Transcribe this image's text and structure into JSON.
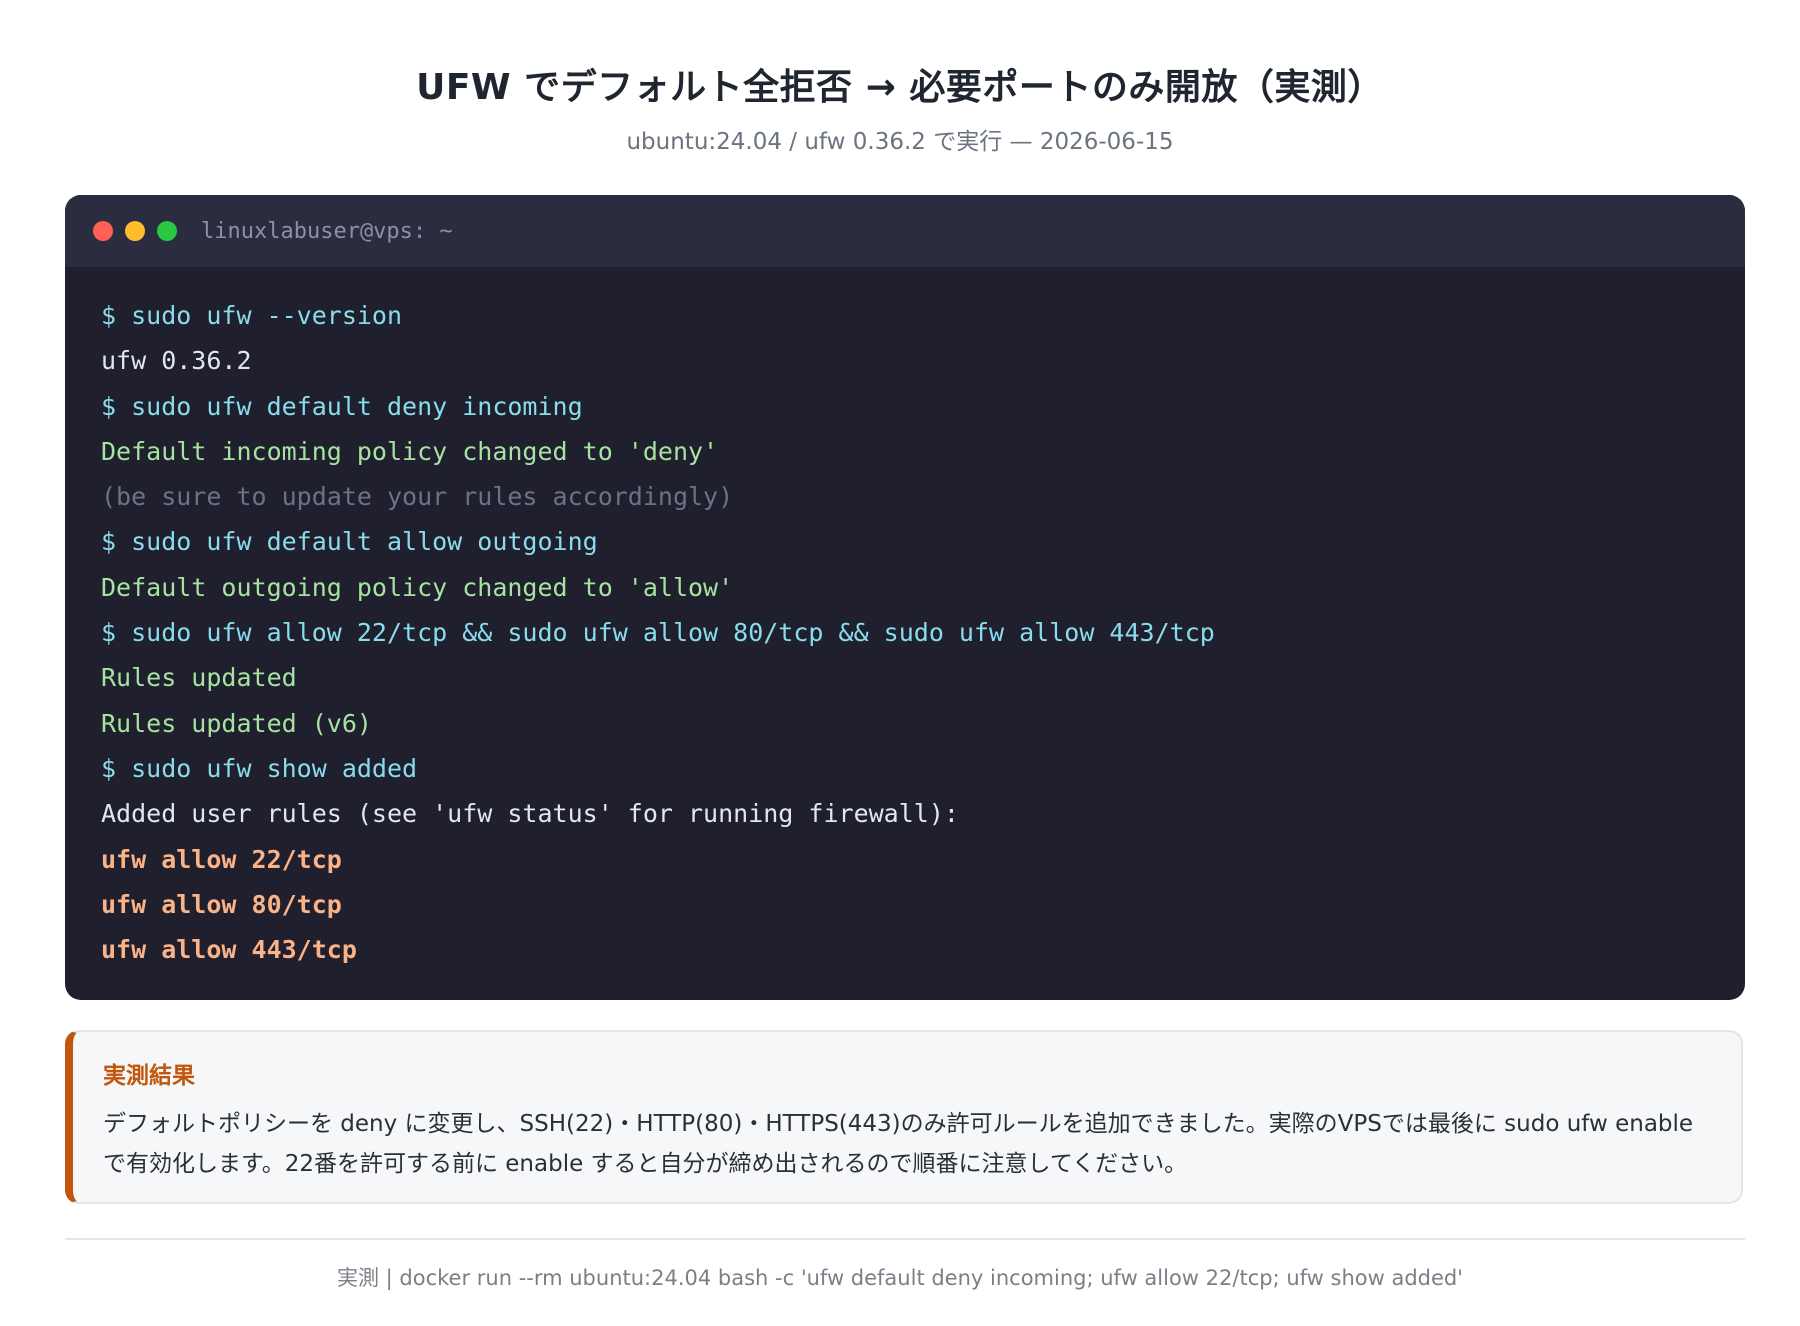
{
  "header": {
    "title": "UFW でデフォルト全拒否 → 必要ポートのみ開放（実測）",
    "subtitle": "ubuntu:24.04 / ufw 0.36.2 で実行 — 2026-06-15"
  },
  "terminal": {
    "window_title": "linuxlabuser@vps: ~",
    "lines": [
      {
        "kind": "cmd",
        "text": "$ sudo ufw --version"
      },
      {
        "kind": "out",
        "text": "ufw 0.36.2"
      },
      {
        "kind": "cmd",
        "text": "$ sudo ufw default deny incoming"
      },
      {
        "kind": "success",
        "text": "Default incoming policy changed to 'deny'"
      },
      {
        "kind": "dim",
        "text": "(be sure to update your rules accordingly)"
      },
      {
        "kind": "cmd",
        "text": "$ sudo ufw default allow outgoing"
      },
      {
        "kind": "success",
        "text": "Default outgoing policy changed to 'allow'"
      },
      {
        "kind": "cmd",
        "text": "$ sudo ufw allow 22/tcp && sudo ufw allow 80/tcp && sudo ufw allow 443/tcp"
      },
      {
        "kind": "success",
        "text": "Rules updated"
      },
      {
        "kind": "success",
        "text": "Rules updated (v6)"
      },
      {
        "kind": "cmd",
        "text": "$ sudo ufw show added"
      },
      {
        "kind": "out",
        "text": "Added user rules (see 'ufw status' for running firewall):"
      },
      {
        "kind": "rule",
        "text": "ufw allow 22/tcp"
      },
      {
        "kind": "rule",
        "text": "ufw allow 80/tcp"
      },
      {
        "kind": "rule",
        "text": "ufw allow 443/tcp"
      }
    ]
  },
  "note": {
    "title": "実測結果",
    "body": "デフォルトポリシーを deny に変更し、SSH(22)・HTTP(80)・HTTPS(443)のみ許可ルールを追加できました。実際のVPSでは最後に sudo ufw enable で有効化します。22番を許可する前に enable すると自分が締め出されるので順番に注意してください。"
  },
  "footer": {
    "text": "実測 | docker run --rm ubuntu:24.04 bash -c 'ufw default deny incoming; ufw allow 22/tcp; ufw show added'"
  },
  "colors": {
    "terminal_bg": "#1f1f2e",
    "titlebar_bg": "#2b2c3f",
    "cmd": "#89dceb",
    "success": "#a6e3a1",
    "rule": "#fab387",
    "accent": "#c2560d"
  }
}
